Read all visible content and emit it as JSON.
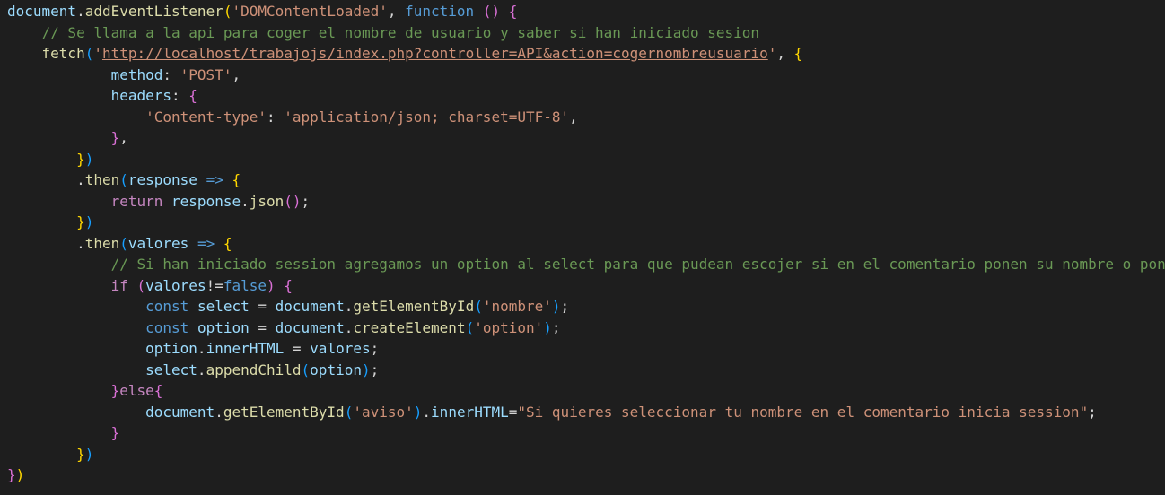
{
  "editor": {
    "lines": [
      [
        [
          "c-var",
          "document"
        ],
        [
          "c-p",
          "."
        ],
        [
          "c-fn",
          "addEventListener"
        ],
        [
          "c-b1",
          "("
        ],
        [
          "c-str",
          "'DOMContentLoaded'"
        ],
        [
          "c-p",
          ", "
        ],
        [
          "c-kw",
          "function"
        ],
        [
          "c-p",
          " "
        ],
        [
          "c-b2",
          "()"
        ],
        [
          "c-p",
          " "
        ],
        [
          "c-b2",
          "{"
        ]
      ],
      [
        [
          "c-p",
          "    "
        ],
        [
          "c-cmt",
          "// Se llama a la api para coger el nombre de usuario y saber si han iniciado sesion"
        ]
      ],
      [
        [
          "c-p",
          "    "
        ],
        [
          "c-fn",
          "fetch"
        ],
        [
          "c-b3",
          "("
        ],
        [
          "c-str",
          "'"
        ],
        [
          "c-url",
          "http://localhost/trabajojs/index.php?controller=API&action=cogernombreusuario"
        ],
        [
          "c-str",
          "'"
        ],
        [
          "c-p",
          ", "
        ],
        [
          "c-b1",
          "{"
        ]
      ],
      [
        [
          "c-p",
          "            "
        ],
        [
          "c-var",
          "method"
        ],
        [
          "c-p",
          ": "
        ],
        [
          "c-str",
          "'POST'"
        ],
        [
          "c-p",
          ","
        ]
      ],
      [
        [
          "c-p",
          "            "
        ],
        [
          "c-var",
          "headers"
        ],
        [
          "c-p",
          ": "
        ],
        [
          "c-b2",
          "{"
        ]
      ],
      [
        [
          "c-p",
          "                "
        ],
        [
          "c-str",
          "'Content-type'"
        ],
        [
          "c-p",
          ": "
        ],
        [
          "c-str",
          "'application/json; charset=UTF-8'"
        ],
        [
          "c-p",
          ","
        ]
      ],
      [
        [
          "c-p",
          "            "
        ],
        [
          "c-b2",
          "}"
        ],
        [
          "c-p",
          ","
        ]
      ],
      [
        [
          "c-p",
          "        "
        ],
        [
          "c-b1",
          "}"
        ],
        [
          "c-b3",
          ")"
        ]
      ],
      [
        [
          "c-p",
          "        ."
        ],
        [
          "c-fn",
          "then"
        ],
        [
          "c-b3",
          "("
        ],
        [
          "c-var",
          "response"
        ],
        [
          "c-p",
          " "
        ],
        [
          "c-kw",
          "=>"
        ],
        [
          "c-p",
          " "
        ],
        [
          "c-b1",
          "{"
        ]
      ],
      [
        [
          "c-p",
          "            "
        ],
        [
          "c-ctl",
          "return"
        ],
        [
          "c-p",
          " "
        ],
        [
          "c-var",
          "response"
        ],
        [
          "c-p",
          "."
        ],
        [
          "c-fn",
          "json"
        ],
        [
          "c-b2",
          "()"
        ],
        [
          "c-p",
          ";"
        ]
      ],
      [
        [
          "c-p",
          "        "
        ],
        [
          "c-b1",
          "}"
        ],
        [
          "c-b3",
          ")"
        ]
      ],
      [
        [
          "c-p",
          "        ."
        ],
        [
          "c-fn",
          "then"
        ],
        [
          "c-b3",
          "("
        ],
        [
          "c-var",
          "valores"
        ],
        [
          "c-p",
          " "
        ],
        [
          "c-kw",
          "=>"
        ],
        [
          "c-p",
          " "
        ],
        [
          "c-b1",
          "{"
        ]
      ],
      [
        [
          "c-p",
          "            "
        ],
        [
          "c-cmt",
          "// Si han iniciado session agregamos un option al select para que pudean escojer si en el comentario ponen su nombre o pon"
        ]
      ],
      [
        [
          "c-p",
          "            "
        ],
        [
          "c-ctl",
          "if"
        ],
        [
          "c-p",
          " "
        ],
        [
          "c-b2",
          "("
        ],
        [
          "c-var",
          "valores"
        ],
        [
          "c-p",
          "!="
        ],
        [
          "c-kw",
          "false"
        ],
        [
          "c-b2",
          ")"
        ],
        [
          "c-p",
          " "
        ],
        [
          "c-b2",
          "{"
        ]
      ],
      [
        [
          "c-p",
          "                "
        ],
        [
          "c-kw",
          "const"
        ],
        [
          "c-p",
          " "
        ],
        [
          "c-var",
          "select"
        ],
        [
          "c-p",
          " = "
        ],
        [
          "c-var",
          "document"
        ],
        [
          "c-p",
          "."
        ],
        [
          "c-fn",
          "getElementById"
        ],
        [
          "c-b3",
          "("
        ],
        [
          "c-str",
          "'nombre'"
        ],
        [
          "c-b3",
          ")"
        ],
        [
          "c-p",
          ";"
        ]
      ],
      [
        [
          "c-p",
          "                "
        ],
        [
          "c-kw",
          "const"
        ],
        [
          "c-p",
          " "
        ],
        [
          "c-var",
          "option"
        ],
        [
          "c-p",
          " = "
        ],
        [
          "c-var",
          "document"
        ],
        [
          "c-p",
          "."
        ],
        [
          "c-fn",
          "createElement"
        ],
        [
          "c-b3",
          "("
        ],
        [
          "c-str",
          "'option'"
        ],
        [
          "c-b3",
          ")"
        ],
        [
          "c-p",
          ";"
        ]
      ],
      [
        [
          "c-p",
          "                "
        ],
        [
          "c-var",
          "option"
        ],
        [
          "c-p",
          "."
        ],
        [
          "c-var",
          "innerHTML"
        ],
        [
          "c-p",
          " = "
        ],
        [
          "c-var",
          "valores"
        ],
        [
          "c-p",
          ";"
        ]
      ],
      [
        [
          "c-p",
          "                "
        ],
        [
          "c-var",
          "select"
        ],
        [
          "c-p",
          "."
        ],
        [
          "c-fn",
          "appendChild"
        ],
        [
          "c-b3",
          "("
        ],
        [
          "c-var",
          "option"
        ],
        [
          "c-b3",
          ")"
        ],
        [
          "c-p",
          ";"
        ]
      ],
      [
        [
          "c-p",
          "            "
        ],
        [
          "c-b2",
          "}"
        ],
        [
          "c-ctl",
          "else"
        ],
        [
          "c-b2",
          "{"
        ]
      ],
      [
        [
          "c-p",
          "                "
        ],
        [
          "c-var",
          "document"
        ],
        [
          "c-p",
          "."
        ],
        [
          "c-fn",
          "getElementById"
        ],
        [
          "c-b3",
          "("
        ],
        [
          "c-str",
          "'aviso'"
        ],
        [
          "c-b3",
          ")"
        ],
        [
          "c-p",
          "."
        ],
        [
          "c-var",
          "innerHTML"
        ],
        [
          "c-p",
          "="
        ],
        [
          "c-str",
          "\"Si quieres seleccionar tu nombre en el comentario inicia session\""
        ],
        [
          "c-p",
          ";"
        ]
      ],
      [
        [
          "c-p",
          "            "
        ],
        [
          "c-b2",
          "}"
        ]
      ],
      [
        [
          "c-p",
          "        "
        ],
        [
          "c-b1",
          "}"
        ],
        [
          "c-b3",
          ")"
        ]
      ],
      [
        [
          "c-b2",
          "}"
        ],
        [
          "c-b1",
          ")"
        ]
      ]
    ]
  }
}
